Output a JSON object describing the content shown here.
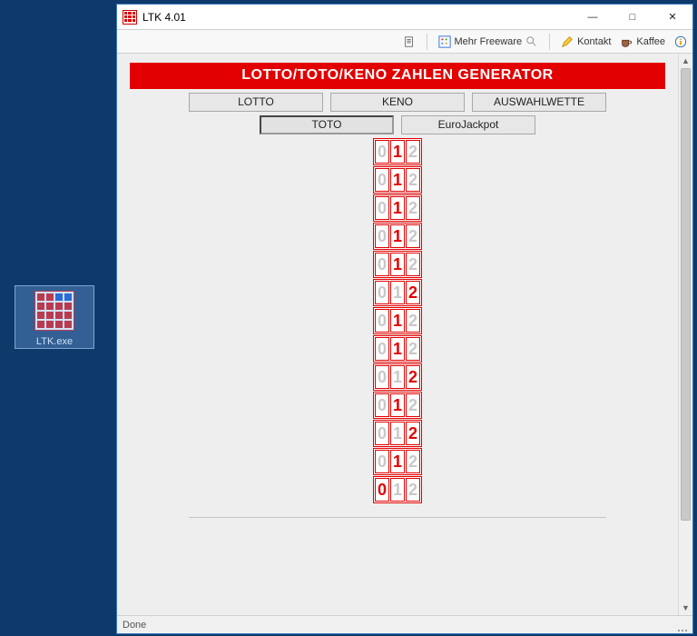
{
  "desktop": {
    "icon_label": "LTK.exe"
  },
  "window": {
    "title": "LTK 4.01",
    "toolbar": {
      "freeware": "Mehr Freeware",
      "kontakt": "Kontakt",
      "kaffee": "Kaffee"
    },
    "status": "Done"
  },
  "app": {
    "banner": "LOTTO/TOTO/KENO ZAHLEN GENERATOR",
    "tabs": {
      "lotto": "LOTTO",
      "keno": "KENO",
      "auswahl": "AUSWAHLWETTE",
      "toto": "TOTO",
      "eurojackpot": "EuroJackpot"
    },
    "rows": [
      {
        "cells": [
          "0",
          "1",
          "2"
        ],
        "sel": 1
      },
      {
        "cells": [
          "0",
          "1",
          "2"
        ],
        "sel": 1
      },
      {
        "cells": [
          "0",
          "1",
          "2"
        ],
        "sel": 1
      },
      {
        "cells": [
          "0",
          "1",
          "2"
        ],
        "sel": 1
      },
      {
        "cells": [
          "0",
          "1",
          "2"
        ],
        "sel": 1
      },
      {
        "cells": [
          "0",
          "1",
          "2"
        ],
        "sel": 2
      },
      {
        "cells": [
          "0",
          "1",
          "2"
        ],
        "sel": 1
      },
      {
        "cells": [
          "0",
          "1",
          "2"
        ],
        "sel": 1
      },
      {
        "cells": [
          "0",
          "1",
          "2"
        ],
        "sel": 2
      },
      {
        "cells": [
          "0",
          "1",
          "2"
        ],
        "sel": 1
      },
      {
        "cells": [
          "0",
          "1",
          "2"
        ],
        "sel": 2
      },
      {
        "cells": [
          "0",
          "1",
          "2"
        ],
        "sel": 1
      },
      {
        "cells": [
          "0",
          "1",
          "2"
        ],
        "sel": 0
      }
    ]
  }
}
